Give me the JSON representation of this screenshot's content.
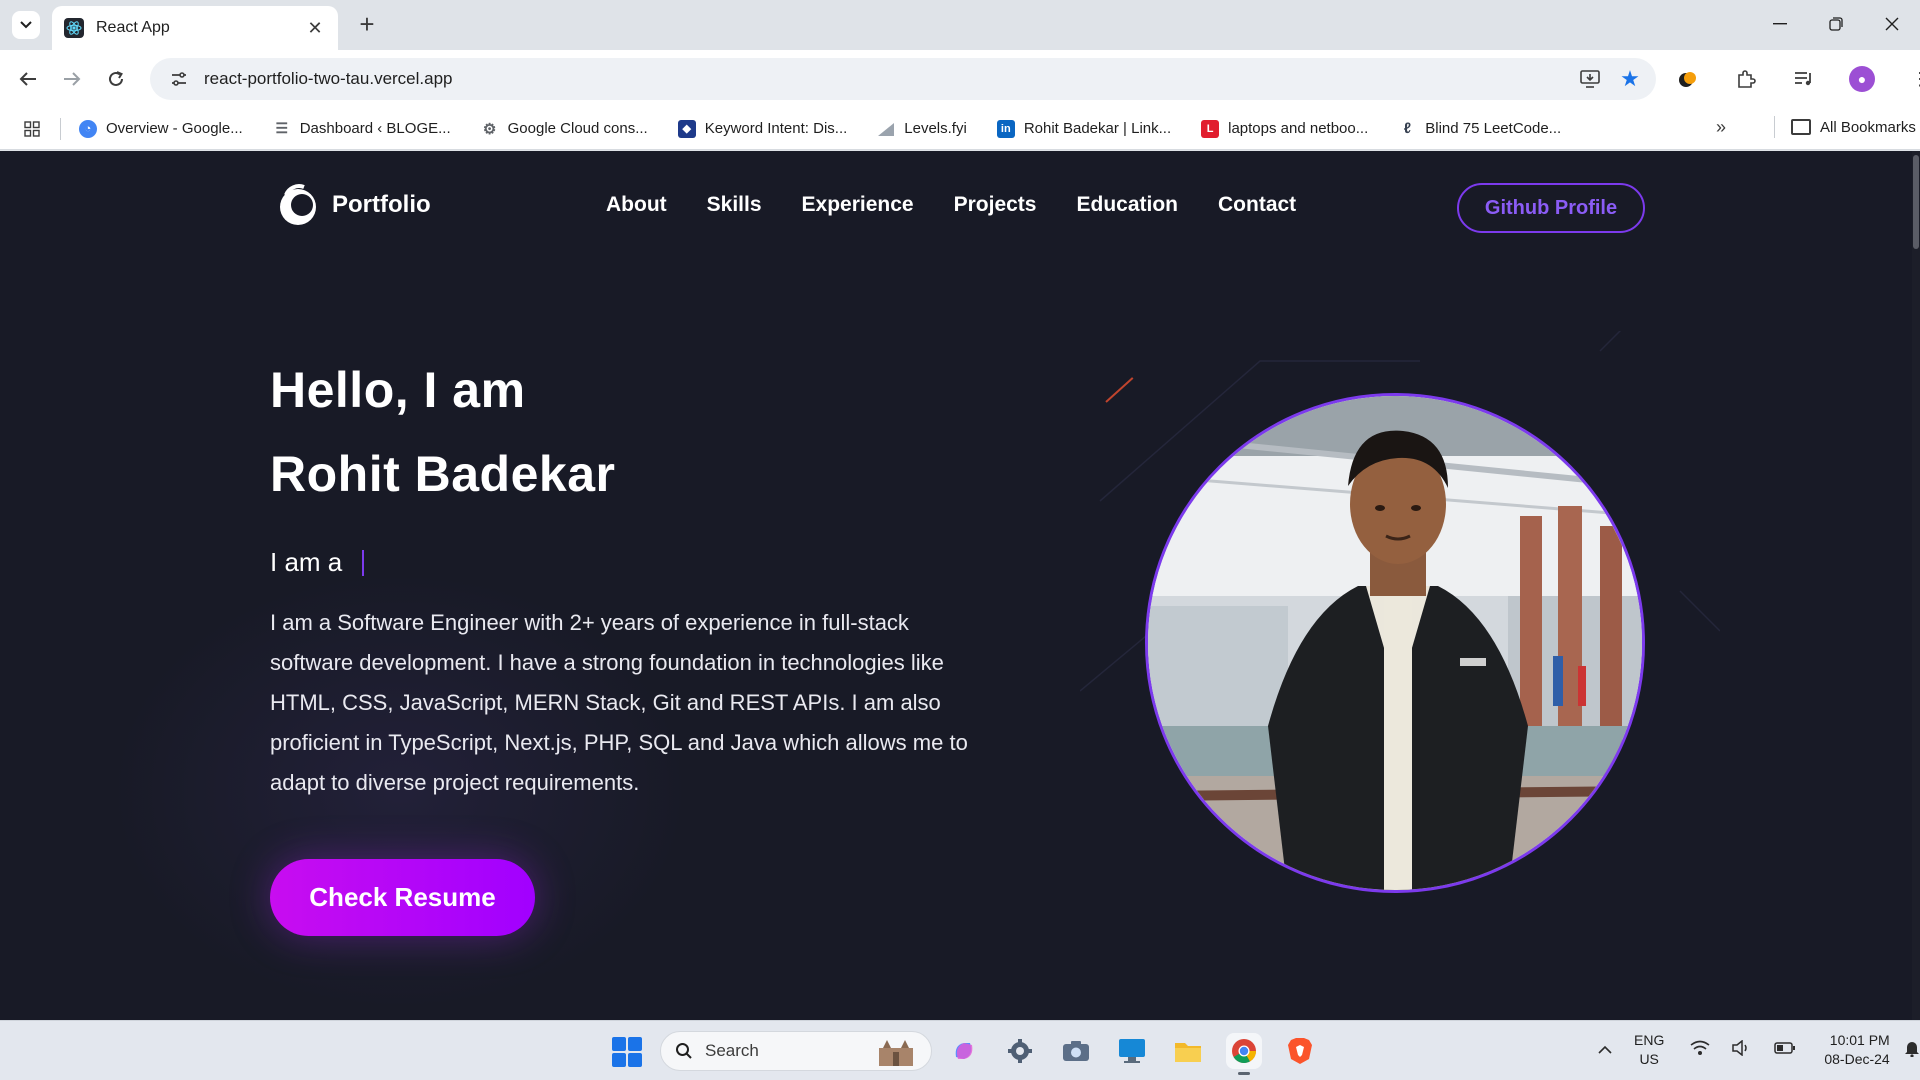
{
  "browser": {
    "tab_title": "React App",
    "url": "react-portfolio-two-tau.vercel.app",
    "bookmarks": [
      {
        "label": "Overview - Google...",
        "color": "#4285f4"
      },
      {
        "label": "Dashboard ‹ BLOGE...",
        "color": "#5f6368"
      },
      {
        "label": "Google Cloud cons...",
        "color": "#5f6368"
      },
      {
        "label": "Keyword Intent: Dis...",
        "color": "#1e3a8a"
      },
      {
        "label": "Levels.fyi",
        "color": "#6b7280"
      },
      {
        "label": "Rohit Badekar | Link...",
        "color": "#0a66c2"
      },
      {
        "label": "laptops and netboo...",
        "color": "#e11d2e"
      },
      {
        "label": "Blind 75 LeetCode...",
        "color": "#374151"
      }
    ],
    "all_bookmarks": "All Bookmarks"
  },
  "site": {
    "logo_text": "Portfolio",
    "nav": [
      "About",
      "Skills",
      "Experience",
      "Projects",
      "Education",
      "Contact"
    ],
    "github_button": "Github Profile",
    "hero": {
      "line1": "Hello, I am",
      "line2": "Rohit Badekar",
      "typing_prefix": "I am a",
      "description": "I am a Software Engineer with 2+ years of experience in full-stack software development. I have a strong foundation in technologies like HTML, CSS, JavaScript, MERN Stack, Git and REST APIs. I am also proficient in TypeScript, Next.js, PHP, SQL and Java which allows me to adapt to diverse project requirements.",
      "resume_button": "Check Resume"
    },
    "accent": "#7c3aed",
    "background": "#181a26"
  },
  "taskbar": {
    "search": "Search",
    "lang_line1": "ENG",
    "lang_line2": "US",
    "time": "10:01 PM",
    "date": "08-Dec-24"
  }
}
